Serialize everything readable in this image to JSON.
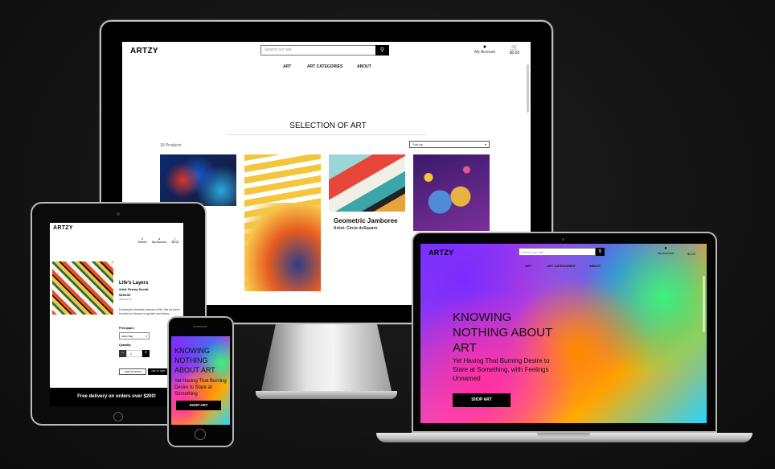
{
  "brand": "ARTZY",
  "desktop": {
    "search_placeholder": "Search our site",
    "account_label": "My Account",
    "cart_total": "$0.00",
    "nav": [
      "ART",
      "ART CATEGORIES",
      "ABOUT"
    ],
    "section_title": "SELECTION OF ART",
    "product_count": "19 Products",
    "sort_label": "Sort by...",
    "products": [
      {
        "title": "Geometric Jamboree",
        "artist": "Artist: Circle deSquaro"
      }
    ]
  },
  "tablet": {
    "search_label": "Search",
    "account_label": "My Account",
    "cart_total": "$0.00",
    "product_title": "Life's Layers",
    "artist": "Artist: Remmy Doodle",
    "price": "$153.00",
    "category": "Abstract Art",
    "description": "Evoking the delicate balance of life, this art piece touches on themes of growth and decay.",
    "print_paper_label": "Print paper:",
    "print_paper_value": "Glitter Bag",
    "quantity_label": "Quantity:",
    "quantity_value": "1",
    "keep_shopping": "KEEP SHOPPING",
    "add_to_cart": "ADD TO CART",
    "delivery_banner": "Free delivery on orders over $200!"
  },
  "phone": {
    "hero_heading": "KNOWING NOTHING ABOUT ART",
    "hero_sub": "Yet Having That Burning Desire to Stare at Something",
    "cta": "SHOP ART"
  },
  "laptop": {
    "search_placeholder": "Search our site",
    "account_label": "My Account",
    "cart_total": "$0.00",
    "nav": [
      "ART",
      "ART CATEGORIES",
      "ABOUT"
    ],
    "hero_heading_l1": "KNOWING",
    "hero_heading_l2": "NOTHING ABOUT",
    "hero_heading_l3": "ART",
    "hero_sub": "Yet Having That Burning Desire to Stare at Something, with Feelings Unnamed",
    "cta": "SHOP ART"
  },
  "colors": {
    "accent": "#000000",
    "background": "#121212",
    "bezel": "#bdbdbd"
  }
}
